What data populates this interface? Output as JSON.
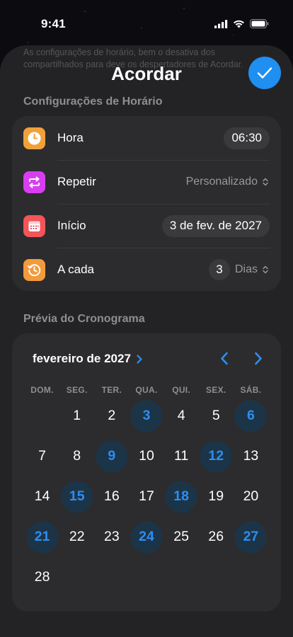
{
  "status": {
    "time": "9:41"
  },
  "background_text": "As configurações de horário, bem o desativa dos compartilhados para deve os despertadores de Acordar.",
  "title": "Acordar",
  "colors": {
    "accent": "#1f8ff1",
    "marked_day": "#2d8ef0",
    "sheet": "#232325",
    "card": "#2c2c2e"
  },
  "schedule_section": {
    "header": "Configurações de Horário",
    "rows": [
      {
        "label": "Hora",
        "value": "06:30",
        "icon": "clock-icon",
        "icon_color": "#f0a13a"
      },
      {
        "label": "Repetir",
        "value": "Personalizado",
        "icon": "repeat-icon",
        "icon_color": "#d83ef0"
      },
      {
        "label": "Início",
        "value": "3 de fev. de 2027",
        "icon": "calendar-icon",
        "icon_color": "#f2555a"
      },
      {
        "label": "A cada",
        "value": "3",
        "unit": "Dias",
        "icon": "history-icon",
        "icon_color": "#f39a3b"
      }
    ]
  },
  "preview_section": {
    "header": "Prévia do Cronograma",
    "month": "fevereiro de 2027",
    "weekdays": [
      "DOM.",
      "SEG.",
      "TER.",
      "QUA.",
      "QUI.",
      "SEX.",
      "SÁB."
    ],
    "first_weekday_offset": 1,
    "days": [
      "1",
      "2",
      "3",
      "4",
      "5",
      "6",
      "7",
      "8",
      "9",
      "10",
      "11",
      "12",
      "13",
      "14",
      "15",
      "16",
      "17",
      "18",
      "19",
      "20",
      "21",
      "22",
      "23",
      "24",
      "25",
      "26",
      "27",
      "28"
    ],
    "marked_days": [
      "3",
      "6",
      "9",
      "12",
      "15",
      "18",
      "21",
      "24",
      "27"
    ]
  }
}
